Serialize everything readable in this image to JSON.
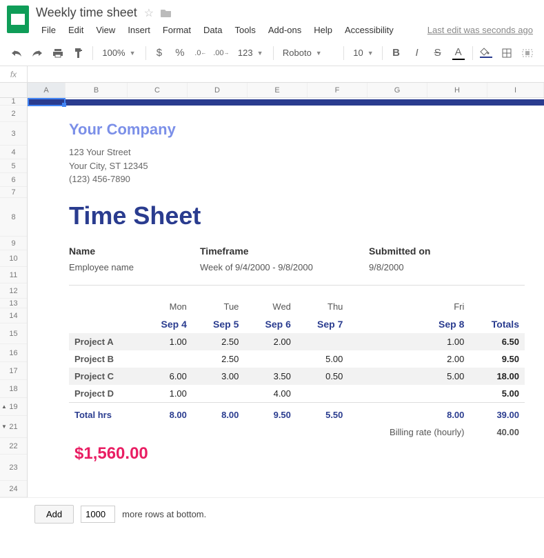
{
  "header": {
    "doc_title": "Weekly time sheet",
    "last_edit": "Last edit was seconds ago"
  },
  "menus": [
    "File",
    "Edit",
    "View",
    "Insert",
    "Format",
    "Data",
    "Tools",
    "Add-ons",
    "Help",
    "Accessibility"
  ],
  "toolbar": {
    "zoom": "100%",
    "currency": "$",
    "percent": "%",
    "number_format": "123",
    "font": "Roboto",
    "font_size": "10",
    "text_color_letter": "A",
    "dec_dec": ".0",
    "dec_inc": ".00"
  },
  "fx": {
    "label": "fx"
  },
  "columns": [
    "A",
    "B",
    "C",
    "D",
    "E",
    "F",
    "G",
    "H",
    "I"
  ],
  "rows": [
    "1",
    "2",
    "3",
    "4",
    "5",
    "6",
    "7",
    "8",
    "9",
    "10",
    "11",
    "12",
    "13",
    "14",
    "15",
    "16",
    "17",
    "18",
    "19",
    "21",
    "22",
    "23",
    "24"
  ],
  "doc": {
    "company": "Your Company",
    "addr1": "123 Your Street",
    "addr2": "Your City, ST 12345",
    "phone": "(123) 456-7890",
    "title": "Time Sheet",
    "meta": {
      "name_label": "Name",
      "name_val": "Employee name",
      "timeframe_label": "Timeframe",
      "timeframe_val": "Week of 9/4/2000 - 9/8/2000",
      "submitted_label": "Submitted on",
      "submitted_val": "9/8/2000"
    },
    "days": [
      "Mon",
      "Tue",
      "Wed",
      "Thu",
      "Fri"
    ],
    "dates": [
      "Sep 4",
      "Sep 5",
      "Sep 6",
      "Sep 7",
      "Sep 8"
    ],
    "totals_label": "Totals",
    "projects": [
      {
        "name": "Project A",
        "vals": [
          "1.00",
          "2.50",
          "2.00",
          "",
          "1.00"
        ],
        "total": "6.50"
      },
      {
        "name": "Project B",
        "vals": [
          "",
          "2.50",
          "",
          "5.00",
          "2.00"
        ],
        "total": "9.50"
      },
      {
        "name": "Project C",
        "vals": [
          "6.00",
          "3.00",
          "3.50",
          "0.50",
          "5.00"
        ],
        "total": "18.00"
      },
      {
        "name": "Project D",
        "vals": [
          "1.00",
          "",
          "4.00",
          "",
          ""
        ],
        "total": "5.00"
      }
    ],
    "total_hrs_label": "Total hrs",
    "total_hrs": [
      "8.00",
      "8.00",
      "9.50",
      "5.50",
      "8.00"
    ],
    "total_hrs_sum": "39.00",
    "billing_label": "Billing rate (hourly)",
    "billing_rate": "40.00",
    "grand_total": "$1,560.00"
  },
  "footer": {
    "add_label": "Add",
    "rows_value": "1000",
    "suffix": "more rows at bottom."
  }
}
